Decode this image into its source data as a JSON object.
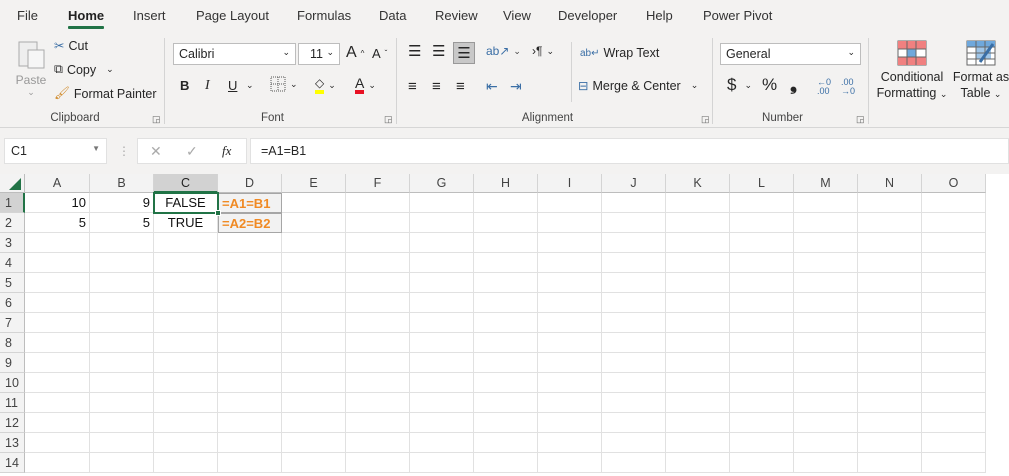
{
  "tabs": [
    "File",
    "Home",
    "Insert",
    "Page Layout",
    "Formulas",
    "Data",
    "Review",
    "View",
    "Developer",
    "Help",
    "Power Pivot"
  ],
  "active_tab": "Home",
  "clipboard": {
    "paste": "Paste",
    "cut": "Cut",
    "copy": "Copy",
    "format_painter": "Format Painter",
    "label": "Clipboard"
  },
  "font": {
    "name": "Calibri",
    "size": "11",
    "bold": "B",
    "italic": "I",
    "underline": "U",
    "color_glyph": "A",
    "label": "Font"
  },
  "alignment": {
    "wrap_text": "Wrap Text",
    "merge_center": "Merge & Center",
    "label": "Alignment"
  },
  "number": {
    "format": "General",
    "currency": "$",
    "percent": "%",
    "comma": "❟",
    "label": "Number"
  },
  "styles": {
    "conditional_1": "Conditional",
    "conditional_2": "Formatting",
    "format_table_1": "Format as",
    "format_table_2": "Table"
  },
  "formula_bar": {
    "name_box": "C1",
    "fx": "fx",
    "formula": "=A1=B1"
  },
  "columns": [
    "A",
    "B",
    "C",
    "D",
    "E",
    "F",
    "G",
    "H",
    "I",
    "J",
    "K",
    "L",
    "M",
    "N",
    "O"
  ],
  "rows": [
    "1",
    "2",
    "3",
    "4",
    "5",
    "6",
    "7",
    "8",
    "9",
    "10",
    "11",
    "12",
    "13",
    "14"
  ],
  "cells": {
    "A1": "10",
    "B1": "9",
    "C1": "FALSE",
    "D1": "=A1=B1",
    "A2": "5",
    "B2": "5",
    "C2": "TRUE",
    "D2": "=A2=B2"
  },
  "selected_cell": "C1",
  "colors": {
    "accent": "#217346",
    "formula_text": "#f08a24"
  }
}
